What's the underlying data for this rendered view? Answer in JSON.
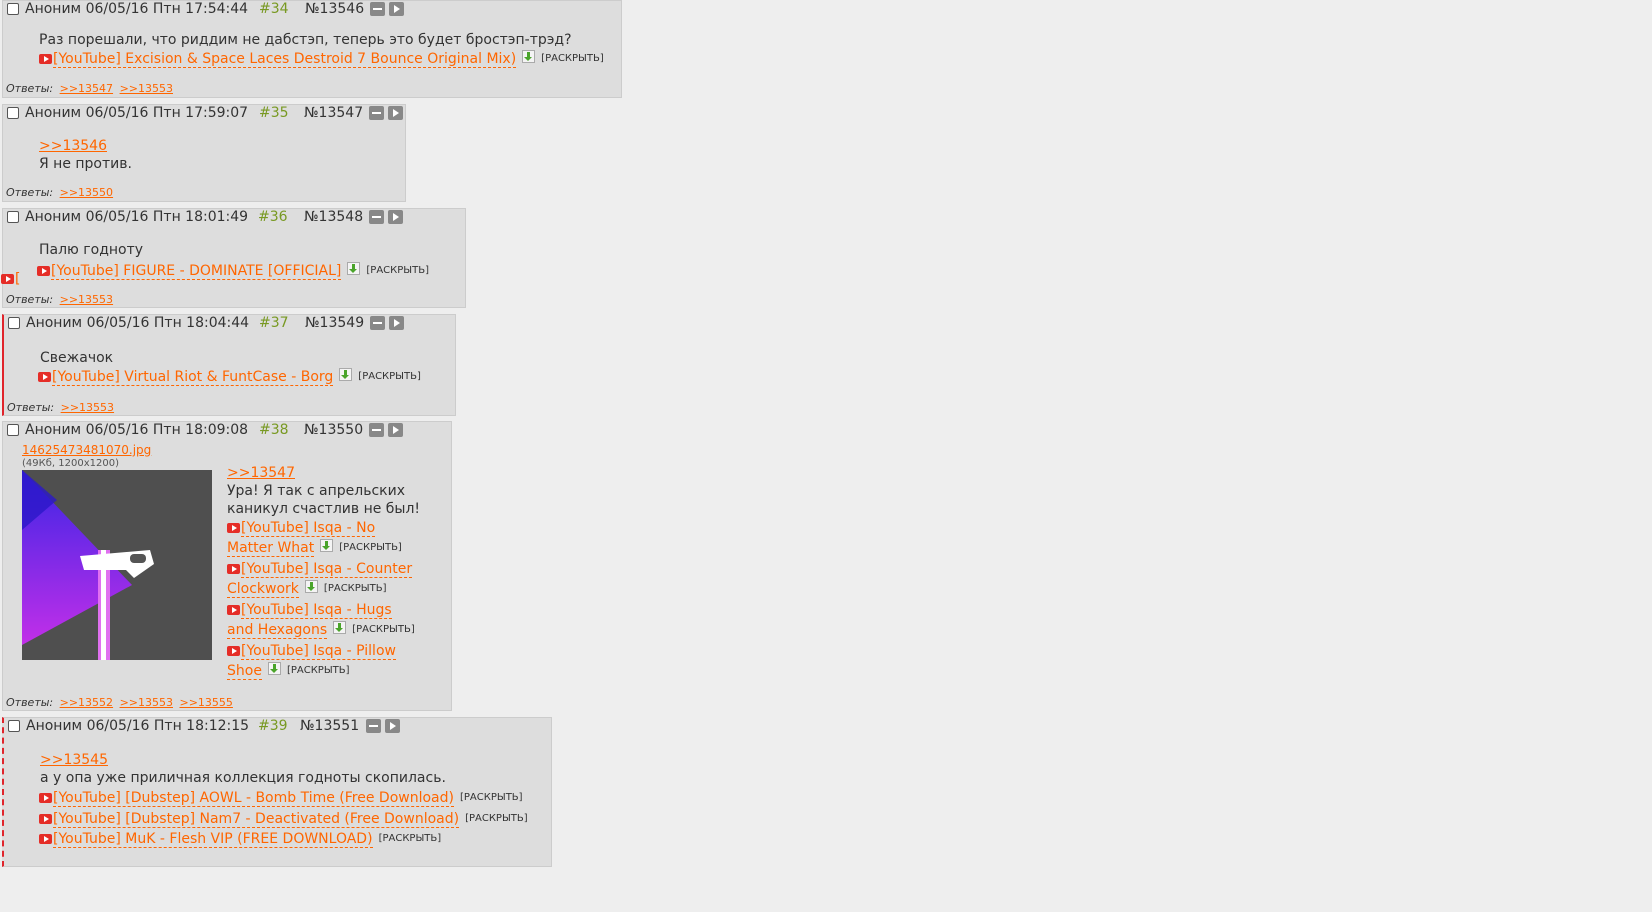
{
  "colors": {
    "accent": "#ff6600",
    "post_number": "#789922",
    "youtube": "#e52d27",
    "post_bg": "#dddddd",
    "page_bg": "#eeeeee"
  },
  "expand_label": "[РАСКРЫТЬ]",
  "replies_label": "Ответы:",
  "posts": [
    {
      "name": "Аноним",
      "datetime": "06/05/16 Птн 17:54:44",
      "num": "#34",
      "id": "№13546",
      "reply_link": "",
      "text": "Раз порешали, что риддим не дабстэп, теперь это будет бростэп-трэд?",
      "youtube": [
        "[YouTube] Excision & Space Laces Destroid 7 Bounce Original Mix)"
      ],
      "replies": [
        ">>13547",
        ">>13553"
      ]
    },
    {
      "name": "Аноним",
      "datetime": "06/05/16 Птн 17:59:07",
      "num": "#35",
      "id": "№13547",
      "reply_link": ">>13546",
      "text": "Я не против.",
      "replies": [
        ">>13550"
      ]
    },
    {
      "name": "Аноним",
      "datetime": "06/05/16 Птн 18:01:49",
      "num": "#36",
      "id": "№13548",
      "text": "Палю годноту",
      "youtube": [
        "[YouTube] FIGURE - DOMINATE [OFFICIAL]"
      ],
      "stray": "[",
      "replies": [
        ">>13553"
      ]
    },
    {
      "name": "Аноним",
      "datetime": "06/05/16 Птн 18:04:44",
      "num": "#37",
      "id": "№13549",
      "text": "Свежачок",
      "youtube": [
        "[YouTube] Virtual Riot & FuntCase - Borg"
      ],
      "replies": [
        ">>13553"
      ]
    },
    {
      "name": "Аноним",
      "datetime": "06/05/16 Птн 18:09:08",
      "num": "#38",
      "id": "№13550",
      "file": {
        "name": "14625473481070.jpg",
        "info": "(49Кб, 1200x1200)"
      },
      "reply_link": ">>13547",
      "text_lines": [
        "Ура! Я так с апрельских",
        "каникул счастлив не был!"
      ],
      "youtube": [
        {
          "line1": "[YouTube] Isqa - No",
          "line2": "Matter What"
        },
        {
          "line1": "[YouTube] Isqa - Counter",
          "line2": "Clockwork"
        },
        {
          "line1": "[YouTube] Isqa - Hugs",
          "line2": "and Hexagons"
        },
        {
          "line1": "[YouTube] Isqa - Pillow",
          "line2": "Shoe"
        }
      ],
      "replies": [
        ">>13552",
        ">>13553",
        ">>13555"
      ]
    },
    {
      "name": "Аноним",
      "datetime": "06/05/16 Птн 18:12:15",
      "num": "#39",
      "id": "№13551",
      "reply_link": ">>13545",
      "text": "а у опа уже приличная коллекция годноты скопилась.",
      "youtube": [
        "[YouTube] [Dubstep] AOWL - Bomb Time (Free Download)",
        "[YouTube] [Dubstep] Nam7 - Deactivated (Free Download)",
        "[YouTube] MuK - Flesh VIP (FREE DOWNLOAD)"
      ]
    }
  ]
}
